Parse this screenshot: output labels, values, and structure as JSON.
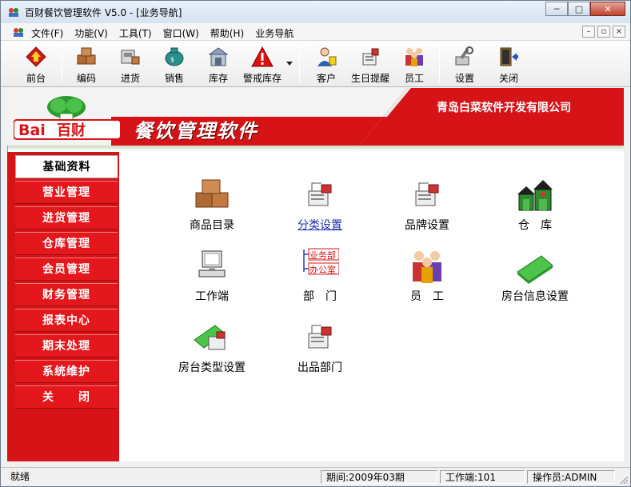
{
  "window": {
    "title": "百财餐饮管理软件 V5.0 - [业务导航]",
    "minimize_glyph": "─",
    "maximize_glyph": "□",
    "close_glyph": "✕"
  },
  "menu": {
    "items": [
      "文件(F)",
      "功能(V)",
      "工具(T)",
      "窗口(W)",
      "帮助(H)",
      "业务导航"
    ],
    "mdi_minimize": "–",
    "mdi_restore": "▫",
    "mdi_close": "×"
  },
  "toolbar": {
    "buttons": [
      {
        "label": "前台",
        "icon": "front-desk-icon"
      },
      {
        "label": "编码",
        "icon": "boxes-icon"
      },
      {
        "label": "进货",
        "icon": "purchase-icon"
      },
      {
        "label": "销售",
        "icon": "sales-icon"
      },
      {
        "label": "库存",
        "icon": "warehouse-icon"
      },
      {
        "label": "警戒库存",
        "icon": "warning-icon"
      },
      {
        "label": "客户",
        "icon": "customer-icon"
      },
      {
        "label": "生日提醒",
        "icon": "birthday-icon"
      },
      {
        "label": "员工",
        "icon": "staff-icon"
      },
      {
        "label": "设置",
        "icon": "settings-icon"
      },
      {
        "label": "关闭",
        "icon": "exit-icon"
      }
    ]
  },
  "banner": {
    "logo_text": "Bai百财",
    "title": "餐饮管理软件",
    "company": "青岛白菜软件开发有限公司",
    "brand_color": "#d61417"
  },
  "sidebar": {
    "items": [
      "基础资料",
      "营业管理",
      "进货管理",
      "仓库管理",
      "会员管理",
      "财务管理",
      "报表中心",
      "期末处理",
      "系统维护",
      "关　　闭"
    ],
    "active_index": 0
  },
  "main": {
    "icons": [
      {
        "label": "商品目录",
        "icon": "boxes-icon"
      },
      {
        "label": "分类设置",
        "icon": "category-icon",
        "link": true
      },
      {
        "label": "品牌设置",
        "icon": "brand-icon"
      },
      {
        "label": "仓　库",
        "icon": "warehouse-building-icon"
      },
      {
        "label": "工作端",
        "icon": "computer-icon"
      },
      {
        "label": "部　门",
        "icon": "department-icon",
        "dept_labels": [
          "业务部",
          "办公室"
        ]
      },
      {
        "label": "员　工",
        "icon": "staff-icon"
      },
      {
        "label": "房台信息设置",
        "icon": "green-folder-icon"
      },
      {
        "label": "房台类型设置",
        "icon": "table-type-icon"
      },
      {
        "label": "出品部门",
        "icon": "output-dept-icon"
      }
    ]
  },
  "status": {
    "ready": "就绪",
    "period": "期间:2009年03期",
    "terminal": "工作端:101",
    "operator": "操作员:ADMIN"
  }
}
